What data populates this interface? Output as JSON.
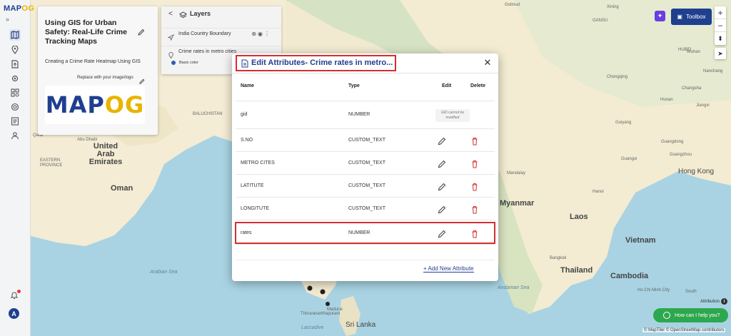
{
  "app": {
    "logo_main": "MAP",
    "logo_accent": "OG"
  },
  "project": {
    "title": "Using GIS for Urban Safety: Real-Life Crime Tracking Maps",
    "subtitle": "Creating a Crime Rate Heatmap Using GIS",
    "replace_logo": "Replace with your image/logo",
    "brand_main": "MAP",
    "brand_accent": "OG"
  },
  "layers": {
    "title": "Layers",
    "items": [
      {
        "name": "India Country Boundary"
      },
      {
        "name": "Crime rates in metro cities"
      }
    ],
    "style_label": "Basic color"
  },
  "toolbar": {
    "toolbox_label": "Toolbox"
  },
  "map": {
    "labels": {
      "golmud": "Golmud",
      "xining": "Xining",
      "gansu": "GANSU",
      "qatar": "Qatar",
      "baluchistan": "BALUCHISTAN",
      "abu_dhabi": "Abu Dhabi",
      "uae": "United Arab Emirates",
      "eastern_province": "EASTERN PROVINCE",
      "oman": "Oman",
      "arabian_sea": "Arabian Sea",
      "laccadive": "Laccadive",
      "thiruvananthapuram": "Thiruvananthapuram",
      "madurai": "Madurai",
      "sri_lanka": "Sri Lanka",
      "mandalay": "Mandalay",
      "myanmar": "Myanmar",
      "laos": "Laos",
      "hanoi": "Hanoi",
      "vietnam": "Vietnam",
      "thailand": "Thailand",
      "cambodia": "Cambodia",
      "bangkok": "Bangkok",
      "hong_kong": "Hong Kong",
      "guangzhou": "Guangzhou",
      "guangdong": "Guangdong",
      "guangxi": "Guangxi",
      "guiyang": "Guiyang",
      "chongqing": "Chongqing",
      "hubei": "HUBEI",
      "changsha": "Changsha",
      "hunan": "Hunan",
      "jiangxi": "Jiangxi",
      "nanchang": "Nanchang",
      "wuhan": "Wuhan",
      "ho_chi_minh": "Ho Chi Minh City",
      "andaman_sea": "Andaman Sea",
      "south": "South"
    }
  },
  "modal": {
    "title": "Edit Attributes- Crime rates in metro...",
    "columns": {
      "name": "Name",
      "type": "Type",
      "edit": "Edit",
      "delete": "Delete"
    },
    "rows": [
      {
        "name": "gid",
        "type": "NUMBER",
        "note": "GID cannot be modified"
      },
      {
        "name": "S.NO",
        "type": "CUSTOM_TEXT"
      },
      {
        "name": "METRO CITES",
        "type": "CUSTOM_TEXT"
      },
      {
        "name": "LATITUTE",
        "type": "CUSTOM_TEXT"
      },
      {
        "name": "LONGITUTE",
        "type": "CUSTOM_TEXT"
      },
      {
        "name": "rates",
        "type": "NUMBER"
      }
    ],
    "add_label": "+ Add New Attribute"
  },
  "footer": {
    "attribution": "Attribution",
    "help": "How can I help you?",
    "copyright": "© MapTiler © OpenStreetMap contributors"
  },
  "colors": {
    "brand": "#1f3f8f",
    "accent": "#e8b400",
    "highlight": "#d32f2f",
    "help_green": "#2ea84e"
  }
}
